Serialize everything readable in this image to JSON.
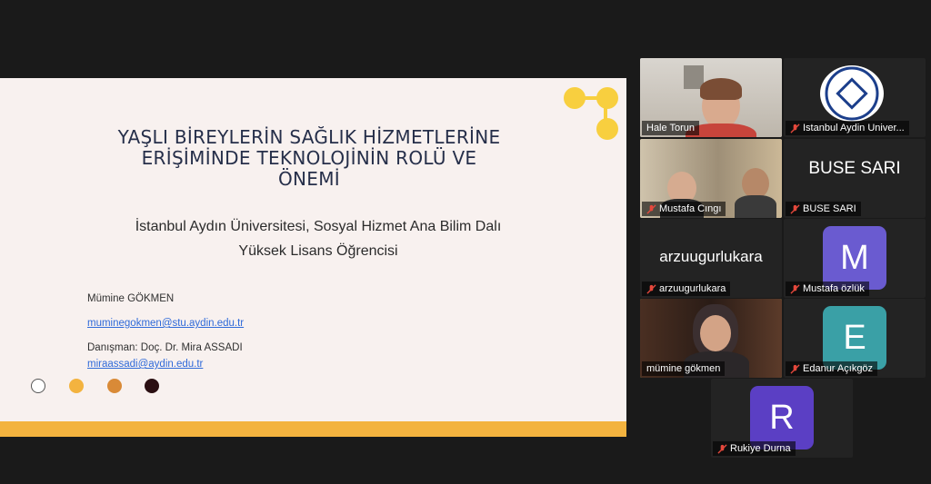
{
  "slide": {
    "title_line1": "YAŞLI BİREYLERİN SAĞLIK HİZMETLERİNE",
    "title_line2": "ERİŞİMİNDE TEKNOLOJİNİN ROLÜ VE",
    "title_line3": "ÖNEMİ",
    "university": "İstanbul Aydın Üniversitesi, Sosyal Hizmet Ana Bilim Dalı",
    "degree": "Yüksek Lisans Öğrencisi",
    "author": "Mümine GÖKMEN",
    "author_email": "muminegokmen@stu.aydin.edu.tr",
    "advisor": "Danışman: Doç. Dr. Mira ASSADI",
    "advisor_email": "miraassadi@aydin.edu.tr",
    "accent_color": "#f3b33f"
  },
  "participants": [
    {
      "name": "Hale Torun",
      "type": "video"
    },
    {
      "name": "Istanbul Aydin Univer...",
      "type": "logo"
    },
    {
      "name": "Mustafa Cıngı",
      "type": "video"
    },
    {
      "name": "BUSE SARI",
      "type": "text",
      "display": "BUSE SARI"
    },
    {
      "name": "arzuugurlukara",
      "type": "text",
      "display": "arzuugurlukara"
    },
    {
      "name": "Mustafa özlük",
      "type": "avatar",
      "letter": "M",
      "color": "#6a5bd0"
    },
    {
      "name": "mümine gökmen",
      "type": "video",
      "active": true
    },
    {
      "name": "Edanur Açıkgöz",
      "type": "avatar",
      "letter": "E",
      "color": "#3aa0a6"
    },
    {
      "name": "Rukiye Durna",
      "type": "avatar",
      "letter": "R",
      "color": "#5b3fc4"
    }
  ]
}
